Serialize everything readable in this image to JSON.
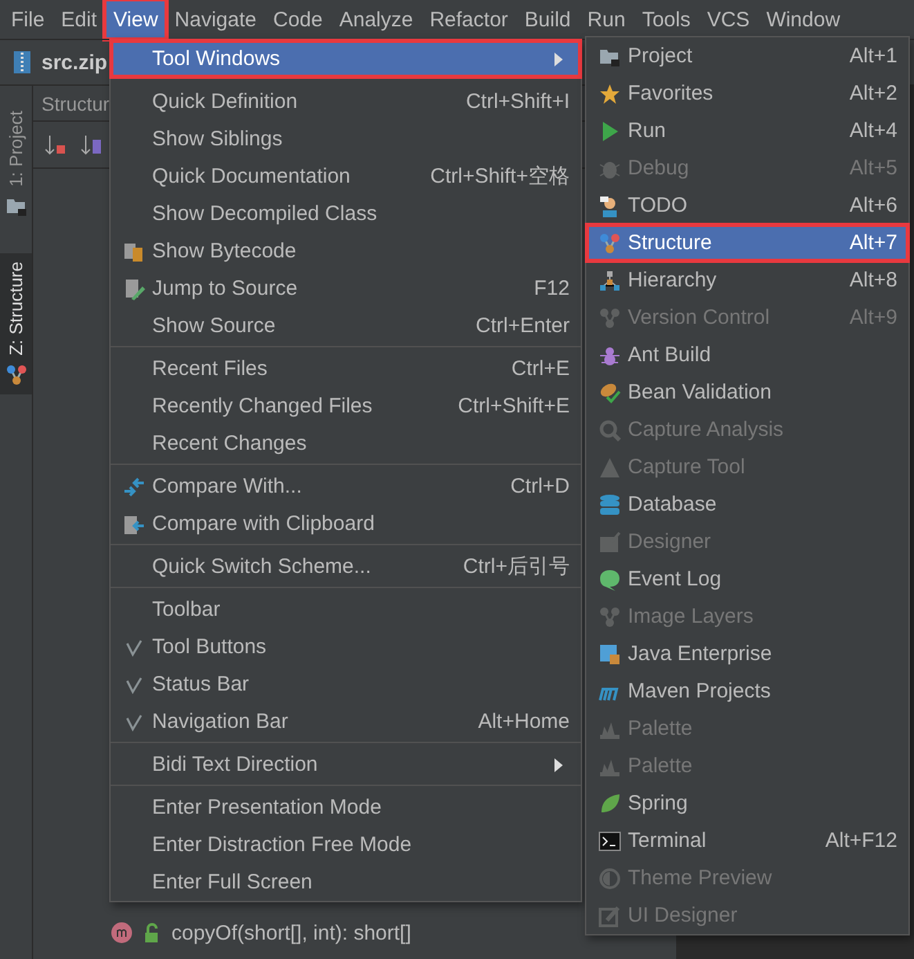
{
  "menubar": [
    {
      "label": "File",
      "selected": false,
      "highlighted": false
    },
    {
      "label": "Edit",
      "selected": false,
      "highlighted": false
    },
    {
      "label": "View",
      "selected": true,
      "highlighted": true
    },
    {
      "label": "Navigate",
      "selected": false,
      "highlighted": false
    },
    {
      "label": "Code",
      "selected": false,
      "highlighted": false
    },
    {
      "label": "Analyze",
      "selected": false,
      "highlighted": false
    },
    {
      "label": "Refactor",
      "selected": false,
      "highlighted": false
    },
    {
      "label": "Build",
      "selected": false,
      "highlighted": false
    },
    {
      "label": "Run",
      "selected": false,
      "highlighted": false
    },
    {
      "label": "Tools",
      "selected": false,
      "highlighted": false
    },
    {
      "label": "VCS",
      "selected": false,
      "highlighted": false
    },
    {
      "label": "Window",
      "selected": false,
      "highlighted": false
    }
  ],
  "breadcrumb": "src.zip",
  "tool_stripe": [
    {
      "label": "1: Project",
      "selected": false
    },
    {
      "label": "Z: Structure",
      "selected": true
    }
  ],
  "structure_panel": {
    "title": "Structur",
    "rows": [
      "copyOf(short[], int): short[]"
    ]
  },
  "view_menu": [
    {
      "kind": "item",
      "label": "Tool Windows",
      "selected": true,
      "submenu": true,
      "highlighted": true
    },
    {
      "kind": "gap"
    },
    {
      "kind": "item",
      "label": "Quick Definition",
      "shortcut": "Ctrl+Shift+I",
      "selected": false
    },
    {
      "kind": "item",
      "label": "Show Siblings",
      "selected": false
    },
    {
      "kind": "item",
      "label": "Quick Documentation",
      "shortcut": "Ctrl+Shift+空格",
      "selected": false
    },
    {
      "kind": "item",
      "label": "Show Decompiled Class",
      "selected": false
    },
    {
      "kind": "item",
      "label": "Show Bytecode",
      "selected": false
    },
    {
      "kind": "item",
      "label": "Jump to Source",
      "shortcut": "F12",
      "selected": false
    },
    {
      "kind": "item",
      "label": "Show Source",
      "shortcut": "Ctrl+Enter",
      "selected": false
    },
    {
      "kind": "separator"
    },
    {
      "kind": "item",
      "label": "Recent Files",
      "shortcut": "Ctrl+E",
      "selected": false
    },
    {
      "kind": "item",
      "label": "Recently Changed Files",
      "shortcut": "Ctrl+Shift+E",
      "selected": false
    },
    {
      "kind": "item",
      "label": "Recent Changes",
      "selected": false
    },
    {
      "kind": "separator"
    },
    {
      "kind": "item",
      "label": "Compare With...",
      "shortcut": "Ctrl+D",
      "selected": false
    },
    {
      "kind": "item",
      "label": "Compare with Clipboard",
      "selected": false
    },
    {
      "kind": "separator"
    },
    {
      "kind": "item",
      "label": "Quick Switch Scheme...",
      "shortcut": "Ctrl+后引号",
      "selected": false
    },
    {
      "kind": "separator"
    },
    {
      "kind": "item",
      "label": "Toolbar",
      "checked": false,
      "selected": false
    },
    {
      "kind": "item",
      "label": "Tool Buttons",
      "checked": true,
      "selected": false
    },
    {
      "kind": "item",
      "label": "Status Bar",
      "checked": true,
      "selected": false
    },
    {
      "kind": "item",
      "label": "Navigation Bar",
      "checked": true,
      "shortcut": "Alt+Home",
      "selected": false
    },
    {
      "kind": "separator"
    },
    {
      "kind": "item",
      "label": "Bidi Text Direction",
      "submenu": true,
      "selected": false
    },
    {
      "kind": "separator"
    },
    {
      "kind": "item",
      "label": "Enter Presentation Mode",
      "selected": false
    },
    {
      "kind": "item",
      "label": "Enter Distraction Free Mode",
      "selected": false
    },
    {
      "kind": "item",
      "label": "Enter Full Screen",
      "selected": false
    }
  ],
  "tool_windows_menu": [
    {
      "label": "Project",
      "shortcut": "Alt+1",
      "disabled": false,
      "selected": false,
      "highlighted": false
    },
    {
      "label": "Favorites",
      "shortcut": "Alt+2",
      "disabled": false,
      "selected": false,
      "highlighted": false
    },
    {
      "label": "Run",
      "shortcut": "Alt+4",
      "disabled": false,
      "selected": false,
      "highlighted": false
    },
    {
      "label": "Debug",
      "shortcut": "Alt+5",
      "disabled": true,
      "selected": false,
      "highlighted": false
    },
    {
      "label": "TODO",
      "shortcut": "Alt+6",
      "disabled": false,
      "selected": false,
      "highlighted": false
    },
    {
      "label": "Structure",
      "shortcut": "Alt+7",
      "disabled": false,
      "selected": true,
      "highlighted": true
    },
    {
      "label": "Hierarchy",
      "shortcut": "Alt+8",
      "disabled": false,
      "selected": false,
      "highlighted": false
    },
    {
      "label": "Version Control",
      "shortcut": "Alt+9",
      "disabled": true,
      "selected": false,
      "highlighted": false
    },
    {
      "label": "Ant Build",
      "disabled": false,
      "selected": false,
      "highlighted": false
    },
    {
      "label": "Bean Validation",
      "disabled": false,
      "selected": false,
      "highlighted": false
    },
    {
      "label": "Capture Analysis",
      "disabled": true,
      "selected": false,
      "highlighted": false
    },
    {
      "label": "Capture Tool",
      "disabled": true,
      "selected": false,
      "highlighted": false
    },
    {
      "label": "Database",
      "disabled": false,
      "selected": false,
      "highlighted": false
    },
    {
      "label": "Designer",
      "disabled": true,
      "selected": false,
      "highlighted": false
    },
    {
      "label": "Event Log",
      "disabled": false,
      "selected": false,
      "highlighted": false
    },
    {
      "label": "Image Layers",
      "disabled": true,
      "selected": false,
      "highlighted": false
    },
    {
      "label": "Java Enterprise",
      "disabled": false,
      "selected": false,
      "highlighted": false
    },
    {
      "label": "Maven Projects",
      "disabled": false,
      "selected": false,
      "highlighted": false
    },
    {
      "label": "Palette",
      "disabled": true,
      "selected": false,
      "highlighted": false
    },
    {
      "label": "Palette",
      "disabled": true,
      "selected": false,
      "highlighted": false
    },
    {
      "label": "Spring",
      "disabled": false,
      "selected": false,
      "highlighted": false
    },
    {
      "label": "Terminal",
      "shortcut": "Alt+F12",
      "disabled": false,
      "selected": false,
      "highlighted": false
    },
    {
      "label": "Theme Preview",
      "disabled": true,
      "selected": false,
      "highlighted": false
    },
    {
      "label": "UI Designer",
      "disabled": true,
      "selected": false,
      "highlighted": false
    }
  ]
}
